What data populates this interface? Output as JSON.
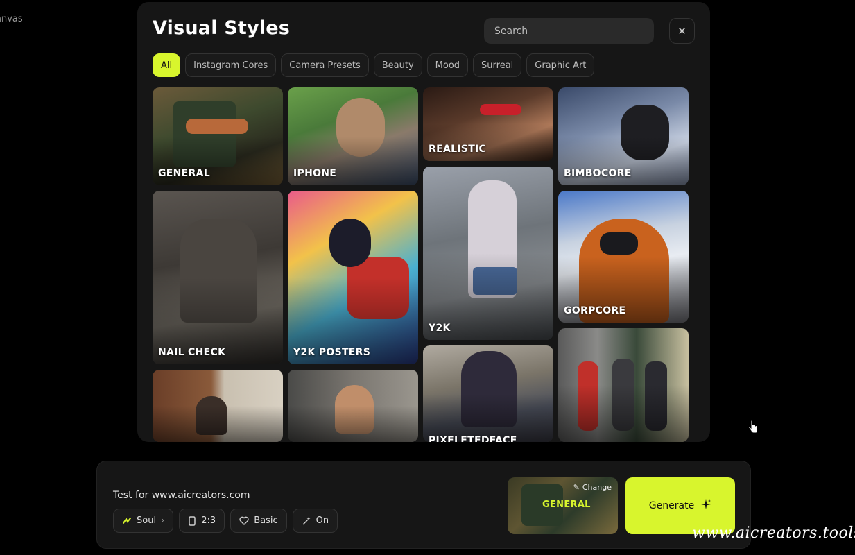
{
  "canvas_label": "anvas",
  "modal": {
    "title": "Visual Styles",
    "search_placeholder": "Search",
    "close_icon": "close-icon",
    "tabs": [
      {
        "label": "All",
        "active": true
      },
      {
        "label": "Instagram Cores",
        "active": false
      },
      {
        "label": "Camera Presets",
        "active": false
      },
      {
        "label": "Beauty",
        "active": false
      },
      {
        "label": "Mood",
        "active": false
      },
      {
        "label": "Surreal",
        "active": false
      },
      {
        "label": "Graphic Art",
        "active": false
      }
    ],
    "styles": [
      {
        "label": "GENERAL"
      },
      {
        "label": "IPHONE"
      },
      {
        "label": "REALISTIC"
      },
      {
        "label": "BIMBOCORE"
      },
      {
        "label": "NAIL CHECK"
      },
      {
        "label": "Y2K POSTERS"
      },
      {
        "label": "Y2K"
      },
      {
        "label": "GORPCORE"
      },
      {
        "label": "PIXELETEDFACE"
      }
    ]
  },
  "composer": {
    "prompt_text": "Test for www.aicreators.com",
    "options": [
      {
        "label": "Soul",
        "icon": "soul-icon"
      },
      {
        "label": "2:3",
        "icon": "aspect-ratio-icon"
      },
      {
        "label": "Basic",
        "icon": "heart-icon"
      },
      {
        "label": "On",
        "icon": "magic-wand-icon"
      }
    ],
    "selected_style": {
      "label": "GENERAL",
      "change_label": "Change"
    },
    "generate_label": "Generate"
  },
  "watermark": "www.aicreators.tools",
  "colors": {
    "accent": "#d8f52d",
    "panel": "#161616",
    "background": "#000000"
  }
}
